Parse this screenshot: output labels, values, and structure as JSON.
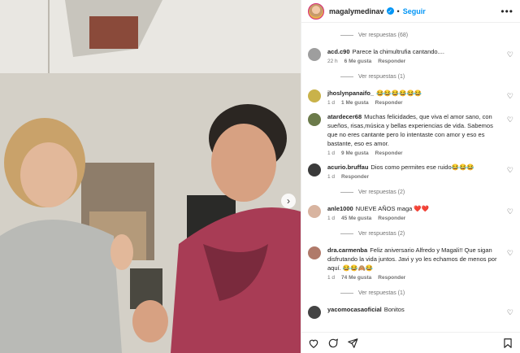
{
  "header": {
    "username": "magalymedinav",
    "follow_label": "Seguir",
    "separator": "•",
    "more": "•••"
  },
  "comments": [
    {
      "type": "viewmore",
      "label": "Ver respuestas (68)"
    },
    {
      "type": "comment",
      "user": "acd.c90",
      "text": "Parece la chimultrufia cantando....",
      "time": "22 h",
      "likes": "6 Me gusta",
      "reply": "Responder",
      "avatar_color": "#9e9e9e"
    },
    {
      "type": "viewmore",
      "label": "Ver respuestas (1)"
    },
    {
      "type": "comment",
      "user": "jhoslynpanaifo_",
      "text": "😂😂😂😂😂😂",
      "time": "1 d",
      "likes": "1 Me gusta",
      "reply": "Responder",
      "avatar_color": "#c9b24a"
    },
    {
      "type": "comment",
      "user": "atardecer68",
      "text": "Muchas felicidades, que viva el amor sano, con sueños, risas,música y bellas experiencias de vida. Sabemos que no eres cantante pero lo intentaste con amor y eso es bastante, eso es amor.",
      "time": "1 d",
      "likes": "9 Me gusta",
      "reply": "Responder",
      "avatar_color": "#6b7a4a"
    },
    {
      "type": "comment",
      "user": "acurio.bruffau",
      "text": "Dios como permites ese ruido😂😂😂",
      "time": "1 d",
      "likes": "",
      "reply": "Responder",
      "avatar_color": "#3a3a3a"
    },
    {
      "type": "viewmore",
      "label": "Ver respuestas (2)"
    },
    {
      "type": "comment",
      "user": "anle1000",
      "text": "NUEVE AÑOS maga ❤️❤️",
      "time": "1 d",
      "likes": "45 Me gusta",
      "reply": "Responder",
      "avatar_color": "#d8b4a0"
    },
    {
      "type": "viewmore",
      "label": "Ver respuestas (2)"
    },
    {
      "type": "comment",
      "user": "dra.carmenba",
      "text": "Feliz aniversario Alfredo y Magali!! Que sigan disfrutando la vida juntos. Javi y yo les echamos de menos por aquí. 😂😂🙈😂",
      "time": "1 d",
      "likes": "74 Me gusta",
      "reply": "Responder",
      "avatar_color": "#b07a6a"
    },
    {
      "type": "viewmore",
      "label": "Ver respuestas (1)"
    },
    {
      "type": "comment",
      "user": "yacomocasaoficial",
      "text": "Bonitos",
      "time": "",
      "likes": "",
      "reply": "",
      "avatar_color": "#444444"
    }
  ],
  "colors": {
    "accent": "#0095f6",
    "text": "#262626",
    "muted": "#737373"
  },
  "icons": [
    "heart-icon",
    "comment-icon",
    "share-icon",
    "save-icon",
    "chevron-right-icon"
  ]
}
